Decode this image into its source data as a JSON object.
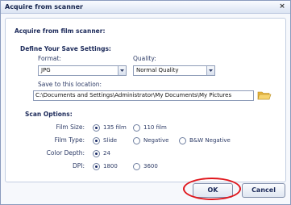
{
  "window": {
    "title": "Acquire from scanner",
    "close_glyph": "×"
  },
  "section_title": "Acquire from film scanner:",
  "save_settings": {
    "heading": "Define Your Save Settings:",
    "format_label": "Format:",
    "format_value": "JPG",
    "quality_label": "Quality:",
    "quality_value": "Normal Quality",
    "location_label": "Save to this location:",
    "location_value": "C:\\Documents and Settings\\Administrator\\My Documents\\My Pictures"
  },
  "scan_options": {
    "heading": "Scan Options:",
    "film_size": {
      "label": "Film Size:",
      "options": [
        "135 film",
        "110 film"
      ],
      "selected": 0
    },
    "film_type": {
      "label": "Film Type:",
      "options": [
        "Slide",
        "Negative",
        "B&W Negative"
      ],
      "selected": 0
    },
    "color_depth": {
      "label": "Color Depth:",
      "options": [
        "24"
      ],
      "selected": 0
    },
    "dpi": {
      "label": "DPI:",
      "options": [
        "1800",
        "3600"
      ],
      "selected": 0
    }
  },
  "buttons": {
    "ok": "OK",
    "cancel": "Cancel"
  },
  "icons": {
    "close": "close-icon",
    "dropdown": "chevron-down-icon",
    "folder": "folder-icon"
  },
  "colors": {
    "highlight": "#e0161c",
    "title_bar": "#dbe4f3"
  }
}
